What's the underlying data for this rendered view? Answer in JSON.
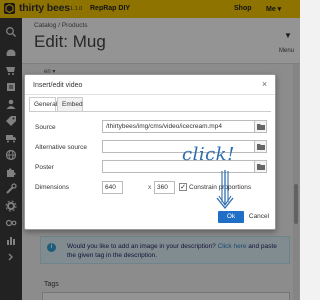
{
  "topbar": {
    "logo_text": "thirty bees",
    "version": "1.1.0",
    "shop_name": "RepRap DIY",
    "shop_link": "Shop",
    "me_link": "Me ▾"
  },
  "sidebar": {
    "icons": [
      "search-icon",
      "dashboard-icon",
      "orders-icon",
      "catalog-icon",
      "customers-icon",
      "price-rules-icon",
      "shipping-icon",
      "localization-icon",
      "modules-icon",
      "preferences-icon",
      "advanced-parameters-icon",
      "administration-icon",
      "stats-icon",
      "expand-icon"
    ]
  },
  "header": {
    "breadcrumb": [
      "Catalog",
      "Products"
    ],
    "breadcrumb_sep": "/",
    "title": "Edit: Mug",
    "menu_label": "Menu"
  },
  "background": {
    "lang_select": "en ▾",
    "info_text_prefix": "Would you like to add an image in your description? ",
    "info_link": "Click here",
    "info_text_suffix": " and paste the given tag in the description.",
    "tags_label": "Tags"
  },
  "dialog": {
    "title": "Insert/edit video",
    "close": "×",
    "tabs": [
      {
        "label": "General",
        "active": true
      },
      {
        "label": "Embed",
        "active": false
      }
    ],
    "fields": {
      "source_label": "Source",
      "source_value": "/thirtybees/img/cms/video/icecream.mp4",
      "alternative_label": "Alternative source",
      "alternative_value": "",
      "poster_label": "Poster",
      "poster_value": "",
      "dimensions_label": "Dimensions",
      "width": "640",
      "x": "x",
      "height": "360",
      "constrain_label": "Constrain proportions",
      "constrain_checked": "✓"
    },
    "ok_label": "Ok",
    "cancel_label": "Cancel"
  },
  "annotation": {
    "text": "click!",
    "color": "#2d6cae"
  },
  "colors": {
    "topbar": "#f7c600",
    "sidebar": "#3c3c3c",
    "ok_button": "#1f6fc7"
  }
}
